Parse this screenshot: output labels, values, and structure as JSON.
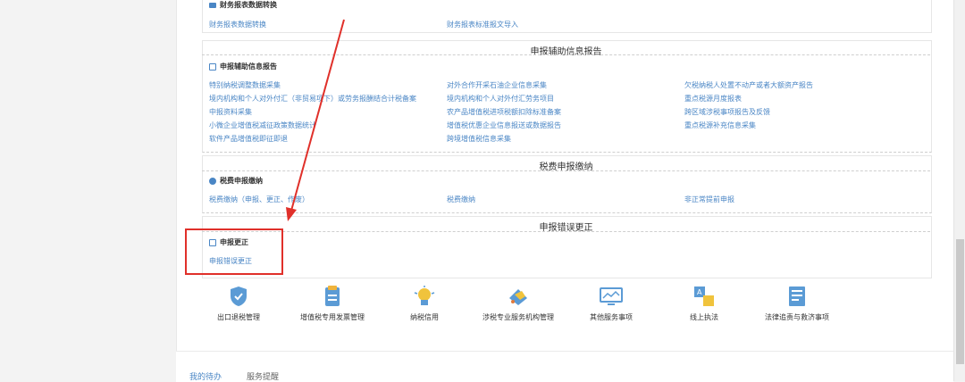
{
  "top_section": {
    "heading": "财务报表数据转换",
    "links": [
      "财务报表数据转换",
      "财务报表标准报文导入"
    ]
  },
  "aux_report": {
    "title": "申报辅助信息报告",
    "subheading": "申报辅助信息报告",
    "links": [
      "特别纳税调整数据采集",
      "对外合作开采石油企业信息采集",
      "欠税纳税人处置不动产或者大额资产报告",
      "境内机构和个人对外付汇（非贸易项下）或劳务报酬结合计税备案",
      "境内机构和个人对外付汇劳务项目",
      "重点税源月度报表",
      "中报资料采集",
      "农产品增值税进项税额扣除标准备案",
      "跨区域涉税事项报告及反馈",
      "小微企业增值税减征政策数据统计",
      "增值税优惠企业信息报送或数据报告",
      "重点税源补充信息采集",
      "软件产品增值税即征即退",
      "跨境增值税信息采集"
    ]
  },
  "tax_payment": {
    "title": "税费申报缴纳",
    "subheading": "税费申报缴纳",
    "links": [
      "税费缴纳（申报、更正、作废）",
      "税费缴纳",
      "非正常提前申报"
    ]
  },
  "correction": {
    "title": "申报错误更正",
    "subheading": "申报更正",
    "links": [
      "申报错误更正"
    ]
  },
  "bottom_nav": [
    {
      "label": "出口退税管理",
      "icon": "shield-icon"
    },
    {
      "label": "增值税专用发票管理",
      "icon": "document-icon"
    },
    {
      "label": "纳税信用",
      "icon": "lightbulb-icon"
    },
    {
      "label": "涉税专业服务机构管理",
      "icon": "tag-icon"
    },
    {
      "label": "其他服务事项",
      "icon": "monitor-icon"
    },
    {
      "label": "线上执法",
      "icon": "translate-icon"
    },
    {
      "label": "法律追责与救济事项",
      "icon": "form-icon"
    }
  ],
  "tabs": [
    "我的待办",
    "服务提醒"
  ],
  "colors": {
    "link": "#4a86c5",
    "annotation": "#e0302a"
  }
}
